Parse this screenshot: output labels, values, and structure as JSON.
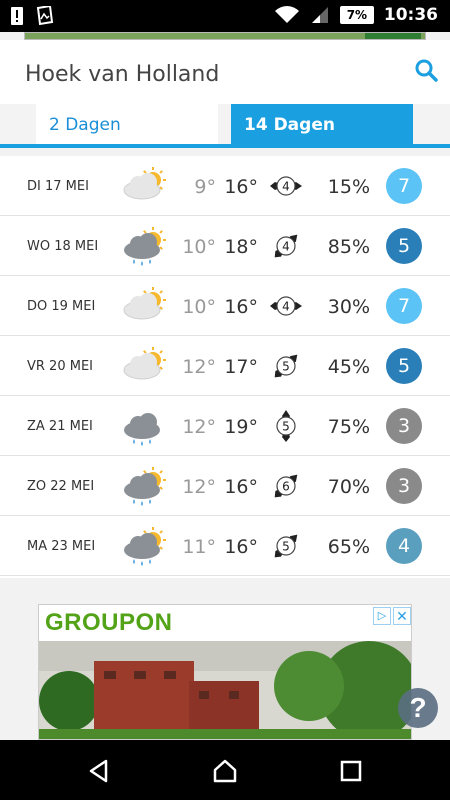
{
  "status": {
    "battery": "7%",
    "time": "10:36"
  },
  "location": {
    "name": "Hoek van Holland"
  },
  "tabs": [
    {
      "label": "2 Dagen",
      "active": false
    },
    {
      "label": "14 Dagen",
      "active": true
    }
  ],
  "forecast": [
    {
      "day": "DI 17 MEI",
      "icon": "sun-cloud-icon",
      "tmin": "9°",
      "tmax": "16°",
      "wind": "4",
      "wind_dir": "E",
      "rain": "15%",
      "uv": "7",
      "uv_color": "#5bc3f5"
    },
    {
      "day": "WO 18 MEI",
      "icon": "sun-cloud-rain-icon",
      "tmin": "10°",
      "tmax": "18°",
      "wind": "4",
      "wind_dir": "NE",
      "rain": "85%",
      "uv": "5",
      "uv_color": "#2a7fb8"
    },
    {
      "day": "DO 19 MEI",
      "icon": "sun-cloud-icon",
      "tmin": "10°",
      "tmax": "16°",
      "wind": "4",
      "wind_dir": "E",
      "rain": "30%",
      "uv": "7",
      "uv_color": "#5bc3f5"
    },
    {
      "day": "VR 20 MEI",
      "icon": "sun-cloud-icon",
      "tmin": "12°",
      "tmax": "17°",
      "wind": "5",
      "wind_dir": "NE",
      "rain": "45%",
      "uv": "5",
      "uv_color": "#2a7fb8"
    },
    {
      "day": "ZA 21 MEI",
      "icon": "cloud-rain-icon",
      "tmin": "12°",
      "tmax": "19°",
      "wind": "5",
      "wind_dir": "N",
      "rain": "75%",
      "uv": "3",
      "uv_color": "#8a8a8a"
    },
    {
      "day": "ZO 22 MEI",
      "icon": "sun-cloud-rain-icon",
      "tmin": "12°",
      "tmax": "16°",
      "wind": "6",
      "wind_dir": "NE",
      "rain": "70%",
      "uv": "3",
      "uv_color": "#8a8a8a"
    },
    {
      "day": "MA 23 MEI",
      "icon": "sun-cloud-rain-icon",
      "tmin": "11°",
      "tmax": "16°",
      "wind": "5",
      "wind_dir": "NE",
      "rain": "65%",
      "uv": "4",
      "uv_color": "#5b9fbf"
    }
  ],
  "ad": {
    "brand": "GROUPON",
    "choices": "▷",
    "close": "✕"
  },
  "help": {
    "label": "?"
  }
}
